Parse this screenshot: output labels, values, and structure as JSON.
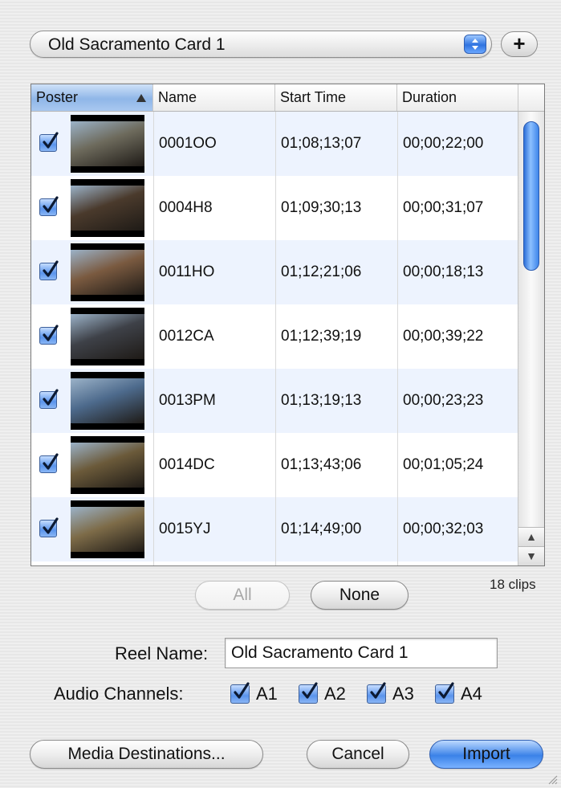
{
  "reel_popup": {
    "selected": "Old Sacramento Card 1"
  },
  "add_button": {
    "label": "+"
  },
  "table": {
    "columns": [
      "Poster",
      "Name",
      "Start Time",
      "Duration"
    ],
    "sort_column": "Poster",
    "rows": [
      {
        "checked": true,
        "name": "0001OO",
        "start": "01;08;13;07",
        "duration": "00;00;22;00",
        "thumb_color": "#6d6a5c"
      },
      {
        "checked": true,
        "name": "0004H8",
        "start": "01;09;30;13",
        "duration": "00;00;31;07",
        "thumb_color": "#4a3a2c"
      },
      {
        "checked": true,
        "name": "0011HO",
        "start": "01;12;21;06",
        "duration": "00;00;18;13",
        "thumb_color": "#7a5a40"
      },
      {
        "checked": true,
        "name": "0012CA",
        "start": "01;12;39;19",
        "duration": "00;00;39;22",
        "thumb_color": "#3e4148"
      },
      {
        "checked": true,
        "name": "0013PM",
        "start": "01;13;19;13",
        "duration": "00;00;23;23",
        "thumb_color": "#4d6a8c"
      },
      {
        "checked": true,
        "name": "0014DC",
        "start": "01;13;43;06",
        "duration": "00;01;05;24",
        "thumb_color": "#6b5a3a"
      },
      {
        "checked": true,
        "name": "0015YJ",
        "start": "01;14;49;00",
        "duration": "00;00;32;03",
        "thumb_color": "#7d6b48"
      }
    ]
  },
  "selection_buttons": {
    "all": "All",
    "none": "None"
  },
  "clip_count": "18 clips",
  "reel_name": {
    "label": "Reel Name:",
    "value": "Old Sacramento Card 1"
  },
  "audio": {
    "label": "Audio Channels:",
    "channels": [
      {
        "name": "A1",
        "checked": true
      },
      {
        "name": "A2",
        "checked": true
      },
      {
        "name": "A3",
        "checked": true
      },
      {
        "name": "A4",
        "checked": true
      }
    ]
  },
  "footer": {
    "media_destinations": "Media Destinations...",
    "cancel": "Cancel",
    "import": "Import"
  }
}
